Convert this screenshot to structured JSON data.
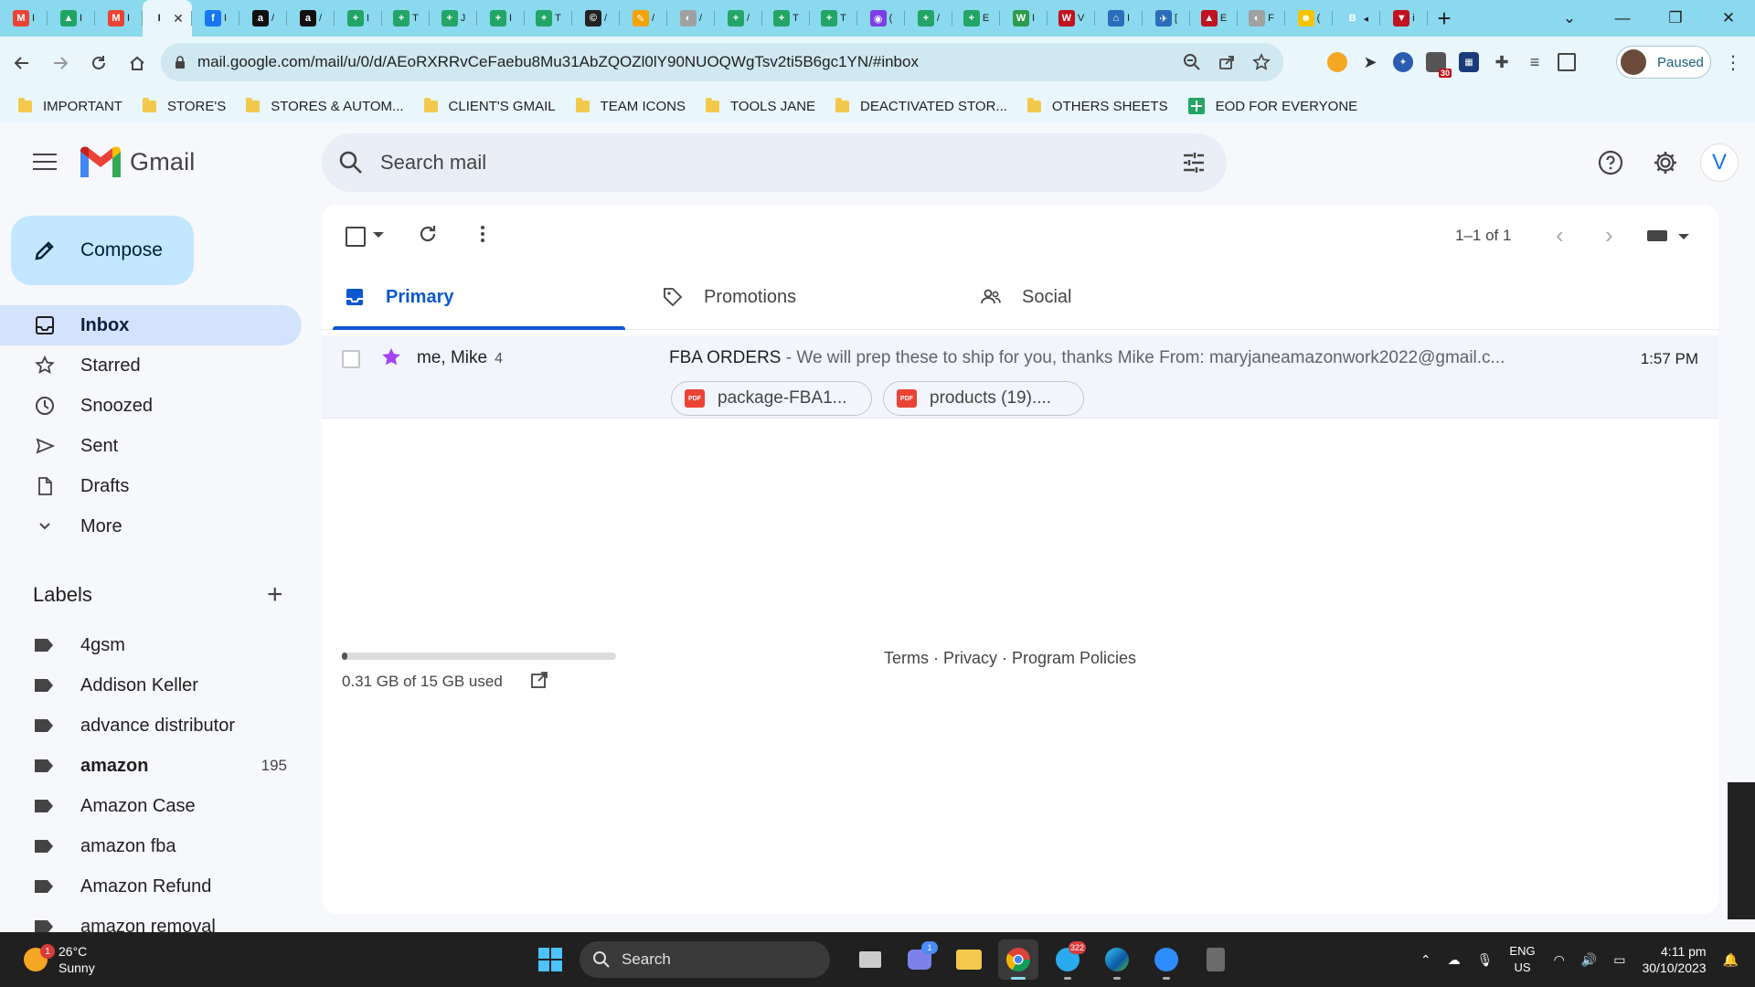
{
  "browser": {
    "tabs": [
      {
        "fav": "M",
        "color": "#ea4335",
        "title": "I"
      },
      {
        "fav": "▲",
        "color": "#1fa463",
        "title": "I"
      },
      {
        "fav": "M",
        "color": "#ea4335",
        "title": "I"
      },
      {
        "fav": "I",
        "color": "#e9f6fb",
        "title": "",
        "active": true
      },
      {
        "fav": "f",
        "color": "#1877f2",
        "title": "I"
      },
      {
        "fav": "a",
        "color": "#111111",
        "title": "/"
      },
      {
        "fav": "a",
        "color": "#111111",
        "title": "/"
      },
      {
        "fav": "+",
        "color": "#23a566",
        "title": "I"
      },
      {
        "fav": "+",
        "color": "#23a566",
        "title": "T"
      },
      {
        "fav": "+",
        "color": "#23a566",
        "title": "J"
      },
      {
        "fav": "+",
        "color": "#23a566",
        "title": "I"
      },
      {
        "fav": "+",
        "color": "#23a566",
        "title": "T"
      },
      {
        "fav": "©",
        "color": "#222222",
        "title": "/"
      },
      {
        "fav": "✎",
        "color": "#f4a300",
        "title": "/"
      },
      {
        "fav": "◐",
        "color": "#a0a0a0",
        "title": "/"
      },
      {
        "fav": "+",
        "color": "#23a566",
        "title": "/"
      },
      {
        "fav": "+",
        "color": "#23a566",
        "title": "T"
      },
      {
        "fav": "+",
        "color": "#23a566",
        "title": "T"
      },
      {
        "fav": "◉",
        "color": "#7b3fe4",
        "title": "("
      },
      {
        "fav": "+",
        "color": "#23a566",
        "title": "/"
      },
      {
        "fav": "+",
        "color": "#23a566",
        "title": "E"
      },
      {
        "fav": "W",
        "color": "#2c9c4b",
        "title": "I"
      },
      {
        "fav": "W",
        "color": "#c1121f",
        "title": "V"
      },
      {
        "fav": "⌂",
        "color": "#2a6ebb",
        "title": "I"
      },
      {
        "fav": "✈",
        "color": "#2a6ebb",
        "title": "["
      },
      {
        "fav": "▲",
        "color": "#c1121f",
        "title": "E"
      },
      {
        "fav": "◐",
        "color": "#a0a0a0",
        "title": "F"
      },
      {
        "fav": "☻",
        "color": "#f4c400",
        "title": "("
      },
      {
        "fav": "B",
        "color": "#8ad9ee",
        "title": "◂"
      },
      {
        "fav": "▼",
        "color": "#c1121f",
        "title": "i"
      }
    ],
    "new_tab": "+",
    "url": "mail.google.com/mail/u/0/d/AEoRXRRvCeFaebu8Mu31AbZQOZl0lY90NUOQWgTsv2ti5B6gc1YN/#inbox",
    "profile_label": "Paused",
    "extension_badge": "30",
    "bookmarks": [
      {
        "label": "IMPORTANT",
        "kind": "folder"
      },
      {
        "label": "STORE'S",
        "kind": "folder"
      },
      {
        "label": "STORES & AUTOM...",
        "kind": "folder"
      },
      {
        "label": "CLIENT'S GMAIL",
        "kind": "folder"
      },
      {
        "label": "TEAM ICONS",
        "kind": "folder"
      },
      {
        "label": "TOOLS JANE",
        "kind": "folder"
      },
      {
        "label": "DEACTIVATED STOR...",
        "kind": "folder"
      },
      {
        "label": "OTHERS SHEETS",
        "kind": "folder"
      },
      {
        "label": "EOD FOR EVERYONE",
        "kind": "sheet"
      }
    ]
  },
  "gmail": {
    "product": "Gmail",
    "search_placeholder": "Search mail",
    "avatar_letter": "V",
    "compose_label": "Compose",
    "nav": [
      {
        "label": "Inbox",
        "icon": "inbox-icon",
        "selected": true
      },
      {
        "label": "Starred",
        "icon": "star-icon"
      },
      {
        "label": "Snoozed",
        "icon": "clock-icon"
      },
      {
        "label": "Sent",
        "icon": "send-icon"
      },
      {
        "label": "Drafts",
        "icon": "draft-icon"
      },
      {
        "label": "More",
        "icon": "chevron-down-icon"
      }
    ],
    "labels_heading": "Labels",
    "labels": [
      {
        "label": "4gsm",
        "count": ""
      },
      {
        "label": "Addison Keller",
        "count": ""
      },
      {
        "label": "advance distributor",
        "count": ""
      },
      {
        "label": "amazon",
        "count": "195",
        "bold": true
      },
      {
        "label": "Amazon Case",
        "count": ""
      },
      {
        "label": "amazon fba",
        "count": ""
      },
      {
        "label": "Amazon Refund",
        "count": ""
      },
      {
        "label": "amazon removal",
        "count": ""
      }
    ],
    "pager": "1–1 of 1",
    "tabs": [
      {
        "label": "Primary",
        "icon": "inbox-icon",
        "selected": true
      },
      {
        "label": "Promotions",
        "icon": "tag-icon"
      },
      {
        "label": "Social",
        "icon": "people-icon"
      }
    ],
    "message": {
      "from": "me, Mike",
      "count": "4",
      "subject": "FBA ORDERS",
      "snippet": " - We will prep these to ship for you, thanks Mike From: maryjaneamazonwork2022@gmail.c...",
      "time": "1:57 PM",
      "attachments": [
        "package-FBA1...",
        "products (19)...."
      ]
    },
    "storage": {
      "text": "0.31 GB of 15 GB used",
      "used_fraction": 0.021
    },
    "footer": "Terms · Privacy · Program Policies",
    "colors": {
      "primary_blue": "#0b57d0",
      "compose_bg": "#c2e7ff",
      "selected_nav": "#d3e3fd",
      "star_purple": "#a142f4"
    }
  },
  "taskbar": {
    "weather_temp": "26°C",
    "weather_desc": "Sunny",
    "weather_badge": "1",
    "search_label": "Search",
    "telegram_badge": "322",
    "teams_badge": "1",
    "lang_line1": "ENG",
    "lang_line2": "US",
    "time": "4:11 pm",
    "date": "30/10/2023"
  }
}
